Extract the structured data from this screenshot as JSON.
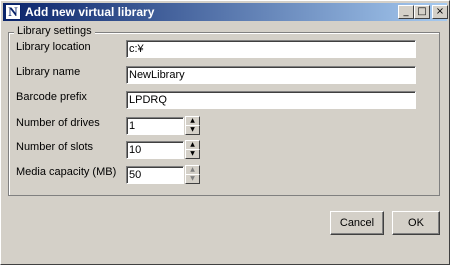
{
  "window": {
    "title": "Add new virtual library",
    "icon_letter": "N",
    "controls": {
      "minimize": "_",
      "maximize": "□",
      "close": "×"
    }
  },
  "group": {
    "title": "Library settings"
  },
  "fields": {
    "location": {
      "label": "Library location",
      "value": "c:¥"
    },
    "name": {
      "label": "Library name",
      "value": "NewLibrary"
    },
    "barcode": {
      "label": "Barcode prefix",
      "value": "LPDRQ"
    },
    "drives": {
      "label": "Number of drives",
      "value": "1"
    },
    "slots": {
      "label": "Number of slots",
      "value": "10"
    },
    "capacity": {
      "label": "Media capacity (MB)",
      "value": "50"
    }
  },
  "spinner_glyphs": {
    "up": "▲",
    "down": "▼"
  },
  "buttons": {
    "cancel": "Cancel",
    "ok": "OK"
  }
}
